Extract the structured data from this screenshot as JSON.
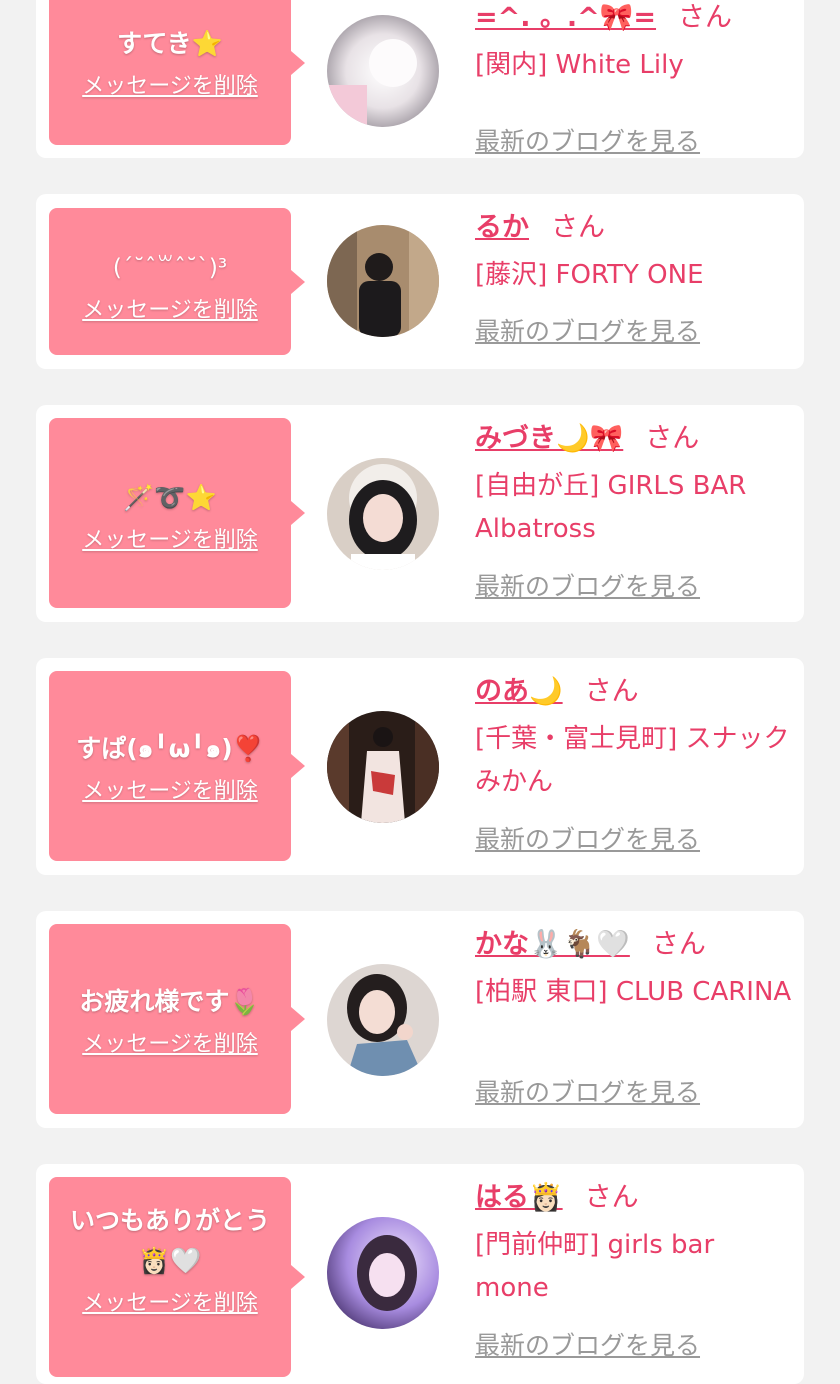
{
  "colors": {
    "background": "#f2f2f2",
    "card": "#ffffff",
    "bubble": "#ff8a9a",
    "accent": "#e83e68",
    "link_gray": "#999999"
  },
  "honorific": "さん",
  "delete_label": "メッセージを削除",
  "blog_label": "最新のブログを見る",
  "messages": [
    {
      "message_lines": [
        "すてき⭐️"
      ],
      "cast_name": "=^. 。.^🎀=",
      "shop": "[関内] White Lily",
      "avatar": "blurred-selfie-photo"
    },
    {
      "message_lines": [
        "(ˊ˘ˆ꒳ˆ˘ˋ)³"
      ],
      "cast_name": "るか",
      "shop": "[藤沢] FORTY ONE",
      "avatar": "mirror-selfie-photo"
    },
    {
      "message_lines": [
        "🪄➰⭐️"
      ],
      "cast_name": "みづき🌙🎀",
      "shop": "[自由が丘] GIRLS BAR Albatross",
      "avatar": "maid-portrait-photo"
    },
    {
      "message_lines": [
        "すぱ(๑╹ω╹๑)❣️"
      ],
      "cast_name": "のあ🌙",
      "shop": "[千葉・富士見町] スナックみかん",
      "avatar": "kimono-photo"
    },
    {
      "message_lines": [
        "お疲れ様です🌷"
      ],
      "cast_name": "かな🐰🐐🤍",
      "shop": "[柏駅 東口] CLUB CARINA",
      "avatar": "portrait-photo"
    },
    {
      "message_lines": [
        "いつもありがとう",
        "👸🏻🤍"
      ],
      "cast_name": "はる👸🏻",
      "shop": "[門前仲町] girls bar mone",
      "avatar": "purple-selfie-photo"
    }
  ]
}
